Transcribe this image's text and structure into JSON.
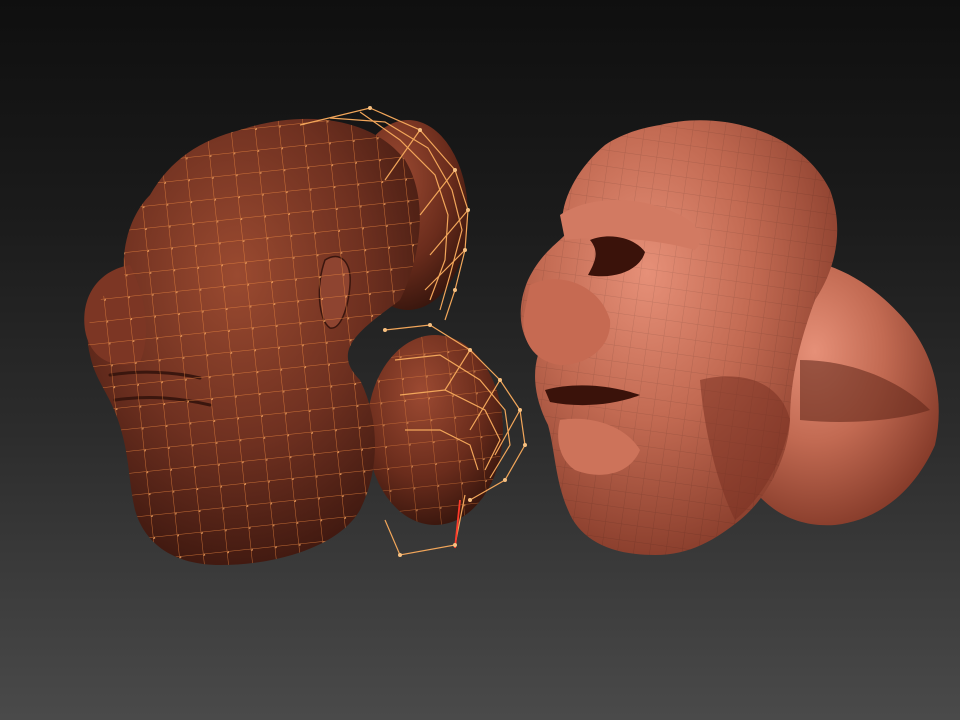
{
  "viewport": {
    "background_top": "#0f0f0f",
    "background_bottom": "#4a4a4a"
  },
  "models": [
    {
      "name": "basemesh-with-cage",
      "surface_color": "#7a3a26",
      "wire_color": "#e0803c",
      "cage_color": "#f2a65a",
      "cage_highlight_color": "#ff3a2a"
    },
    {
      "name": "low-poly-head",
      "surface_color": "#b8604a",
      "shadow_color": "#5c2418",
      "highlight_color": "#e08a72"
    }
  ]
}
